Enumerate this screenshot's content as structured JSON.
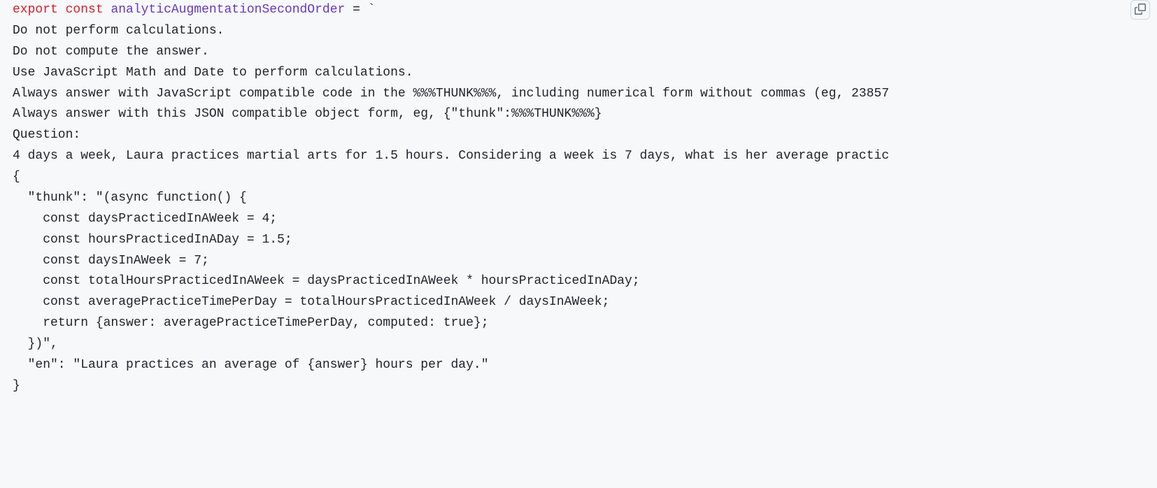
{
  "code": {
    "t_export": "export",
    "t_const": "const",
    "t_name": "analyticAugmentationSecondOrder",
    "t_eq_backtick": " = `",
    "l2": "Do not perform calculations.",
    "l3": "Do not compute the answer.",
    "l4": "Use JavaScript Math and Date to perform calculations.",
    "l5": "Always answer with JavaScript compatible code in the %%%THUNK%%%, including numerical form without commas (eg, 23857",
    "l6": "Always answer with this JSON compatible object form, eg, {\"thunk\":%%%THUNK%%%}",
    "l7": "Question:",
    "l8": "4 days a week, Laura practices martial arts for 1.5 hours. Considering a week is 7 days, what is her average practic",
    "l9": "{ ",
    "l10": "  \"thunk\": \"(async function() {",
    "l11": "    const daysPracticedInAWeek = 4;",
    "l12": "    const hoursPracticedInADay = 1.5;",
    "l13": "    const daysInAWeek = 7;",
    "l14": "    const totalHoursPracticedInAWeek = daysPracticedInAWeek * hoursPracticedInADay;",
    "l15": "    const averagePracticeTimePerDay = totalHoursPracticedInAWeek / daysInAWeek;",
    "l16": "    return {answer: averagePracticeTimePerDay, computed: true};",
    "l17": "  })\",",
    "l18": "  \"en\": \"Laura practices an average of {answer} hours per day.\"",
    "l19": "}"
  }
}
